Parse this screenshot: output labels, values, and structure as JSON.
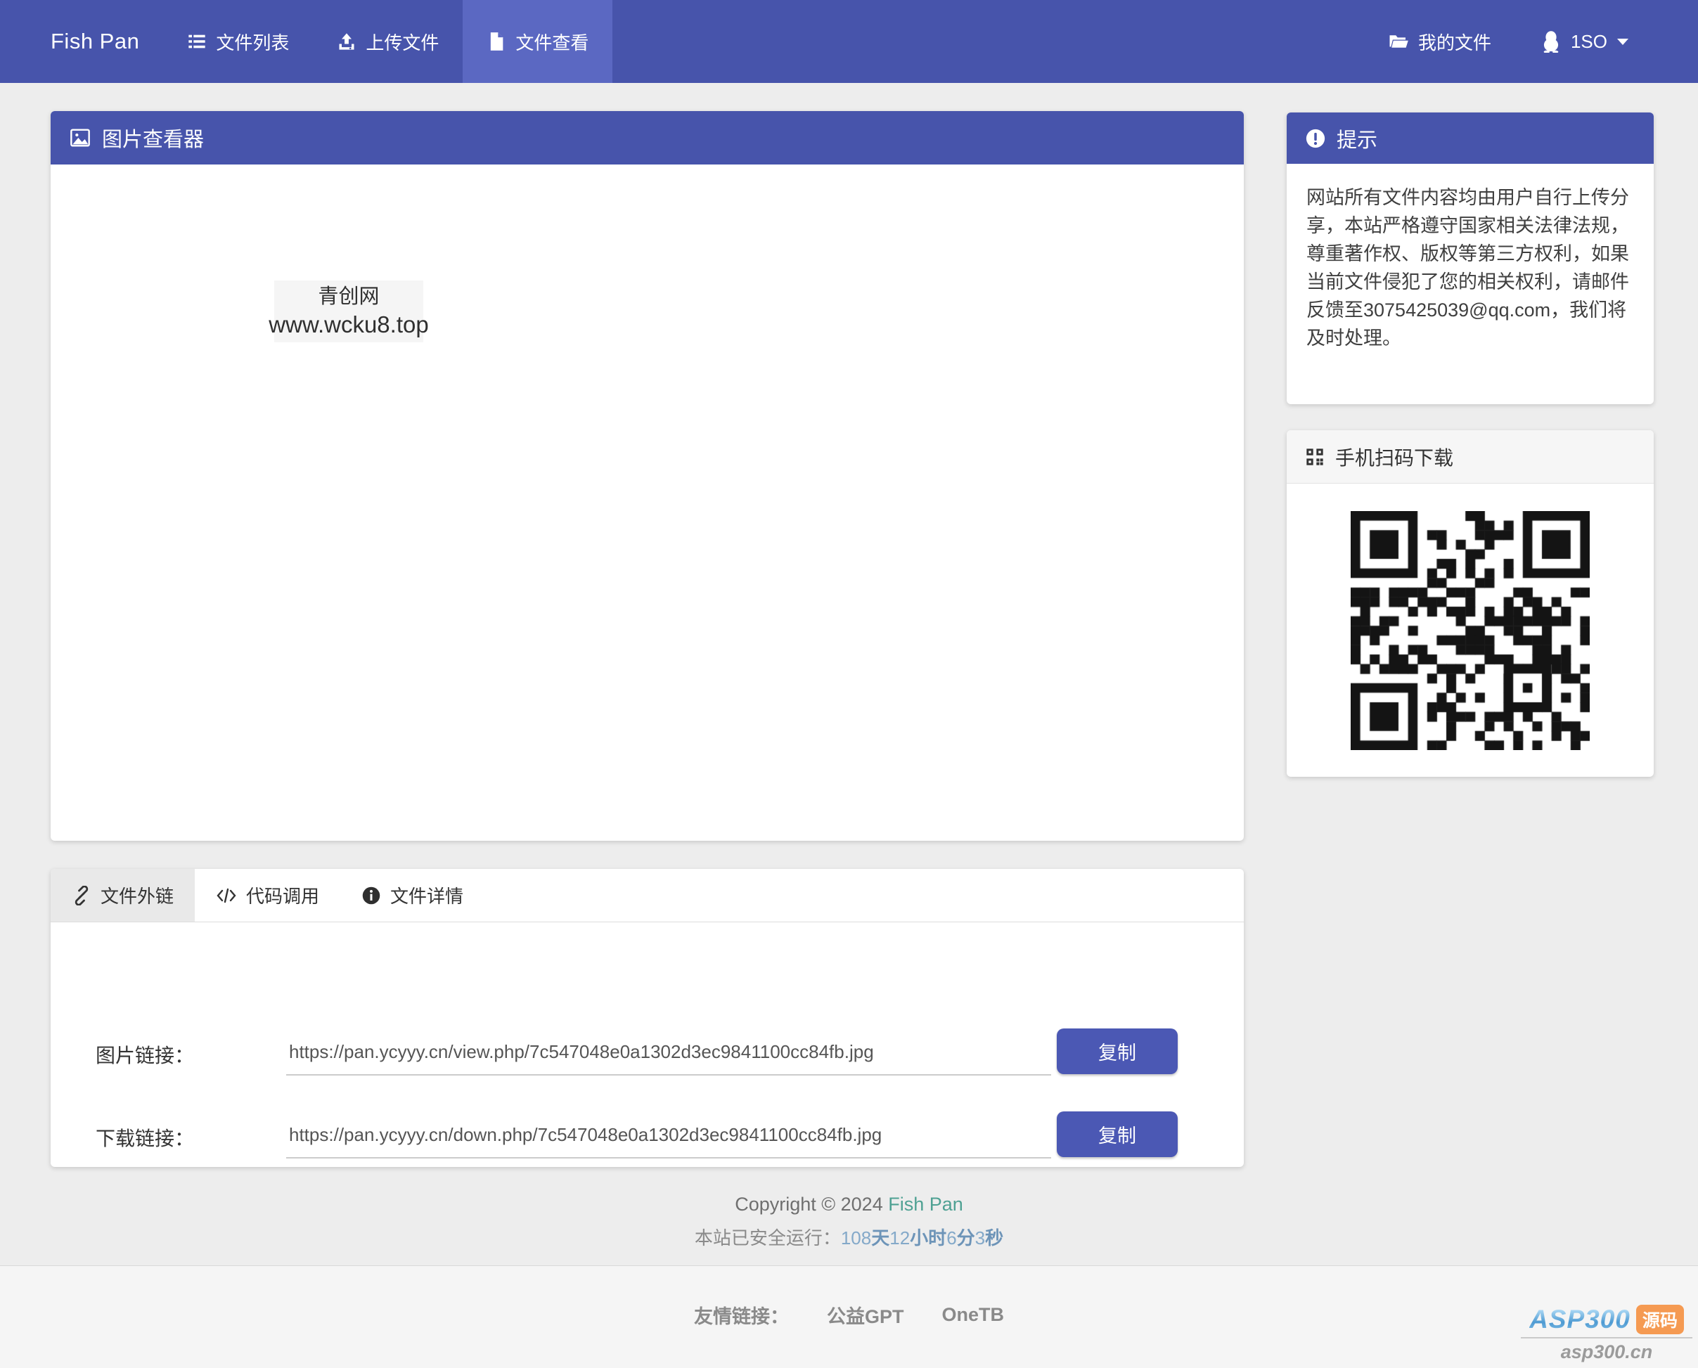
{
  "colors": {
    "accent": "#4754ab",
    "accent_light": "#5b68c2",
    "button": "#4b58b4",
    "footer_link_teal": "#4fa193",
    "uptime_blue": "#84a9c9",
    "watermark_orange": "#f59a52"
  },
  "navbar": {
    "brand": "Fish Pan",
    "items": [
      {
        "label": "文件列表"
      },
      {
        "label": "上传文件"
      },
      {
        "label": "文件查看"
      }
    ],
    "my_files": "我的文件",
    "user": "1SO"
  },
  "viewer": {
    "title": "图片查看器",
    "image_line1": "青创网",
    "image_line2": "www.wcku8.top"
  },
  "tip": {
    "title": "提示",
    "body": "网站所有文件内容均由用户自行上传分享，本站严格遵守国家相关法律法规，尊重著作权、版权等第三方权利，如果当前文件侵犯了您的相关权利，请邮件反馈至3075425039@qq.com，我们将及时处理。"
  },
  "qr": {
    "title": "手机扫码下载"
  },
  "tabs": {
    "t1": "文件外链",
    "t2": "代码调用",
    "t3": "文件详情"
  },
  "links": {
    "row1": {
      "label": "图片链接：",
      "value": "https://pan.ycyyy.cn/view.php/7c547048e0a1302d3ec9841100cc84fb.jpg",
      "button": "复制"
    },
    "row2": {
      "label": "下载链接：",
      "value": "https://pan.ycyyy.cn/down.php/7c547048e0a1302d3ec9841100cc84fb.jpg",
      "button": "复制"
    }
  },
  "footer": {
    "copyright": "Copyright © 2024",
    "brand": "Fish Pan",
    "uptime_label": "本站已安全运行：",
    "uptime": {
      "days": "108",
      "days_unit": "天",
      "hours": "12",
      "hours_unit": "小时",
      "minutes": "6",
      "minutes_unit": "分",
      "seconds": "3",
      "seconds_unit": "秒"
    },
    "friends_label": "友情链接：",
    "friend1": "公益GPT",
    "friend2": "OneTB"
  },
  "watermark": {
    "logo": "ASP300",
    "badge": "源码",
    "domain": "asp300.cn"
  }
}
